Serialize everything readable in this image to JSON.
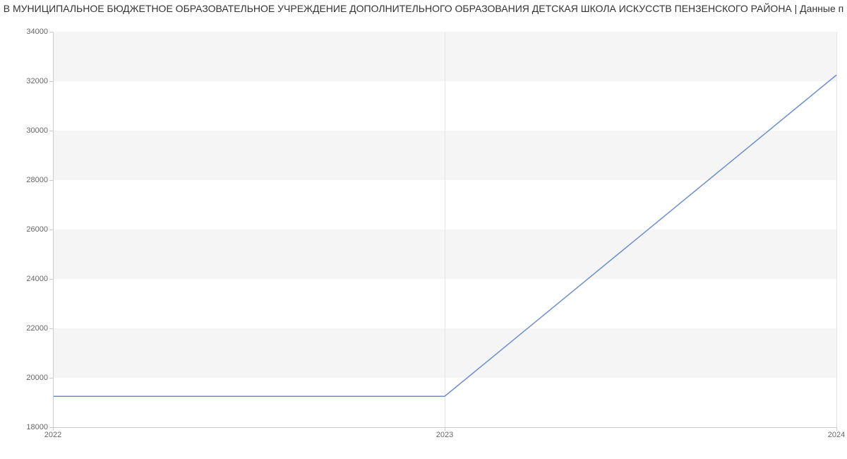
{
  "chart_data": {
    "type": "line",
    "title": "В МУНИЦИПАЛЬНОЕ БЮДЖЕТНОЕ ОБРАЗОВАТЕЛЬНОЕ УЧРЕЖДЕНИЕ ДОПОЛНИТЕЛЬНОГО ОБРАЗОВАНИЯ ДЕТСКАЯ ШКОЛА ИСКУССТВ ПЕНЗЕНСКОГО РАЙОНА | Данные п",
    "xlabel": "",
    "ylabel": "",
    "x": [
      2022,
      2023,
      2024
    ],
    "values": [
      19250,
      19250,
      32250
    ],
    "xlim": [
      2022,
      2024
    ],
    "ylim": [
      18000,
      34000
    ],
    "x_ticks": [
      2022,
      2023,
      2024
    ],
    "y_ticks": [
      18000,
      20000,
      22000,
      24000,
      26000,
      28000,
      30000,
      32000,
      34000
    ],
    "line_color": "#6b8ecf",
    "band_color": "#f5f5f5"
  }
}
